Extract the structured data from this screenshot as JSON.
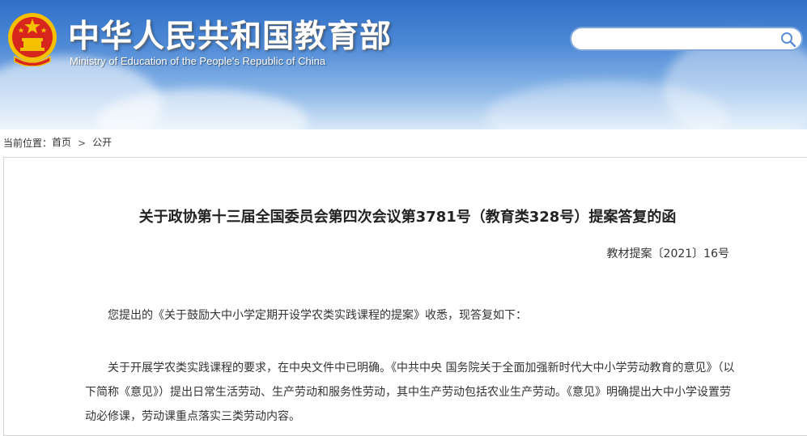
{
  "header": {
    "title_cn": "中华人民共和国教育部",
    "title_en": "Ministry of Education of the People's Republic of China",
    "colors": {
      "sky_top": "#2f6fc7",
      "sky_bottom": "#d9e9f8",
      "emblem_red": "#d7261e",
      "emblem_gold": "#f5c000"
    }
  },
  "search": {
    "value": "",
    "placeholder": "",
    "icon": "search-icon"
  },
  "breadcrumb": {
    "prefix": "当前位置：",
    "items": [
      "首页",
      "公开"
    ],
    "separator_icon": "chevron-right-icon"
  },
  "document": {
    "title": "关于政协第十三届全国委员会第四次会议第3781号（教育类328号）提案答复的函",
    "number": "教材提案〔2021〕16号",
    "paragraphs": [
      "您提出的《关于鼓励大中小学定期开设学农类实践课程的提案》收悉，现答复如下：",
      "关于开展学农类实践课程的要求，在中央文件中已明确。《中共中央 国务院关于全面加强新时代大中小学劳动教育的意见》（以下简称《意见》）提出日常生活劳动、生产劳动和服务性劳动，其中生产劳动包括农业生产劳动。《意见》明确提出大中小学设置劳动必修课，劳动课重点落实三类劳动内容。"
    ]
  }
}
